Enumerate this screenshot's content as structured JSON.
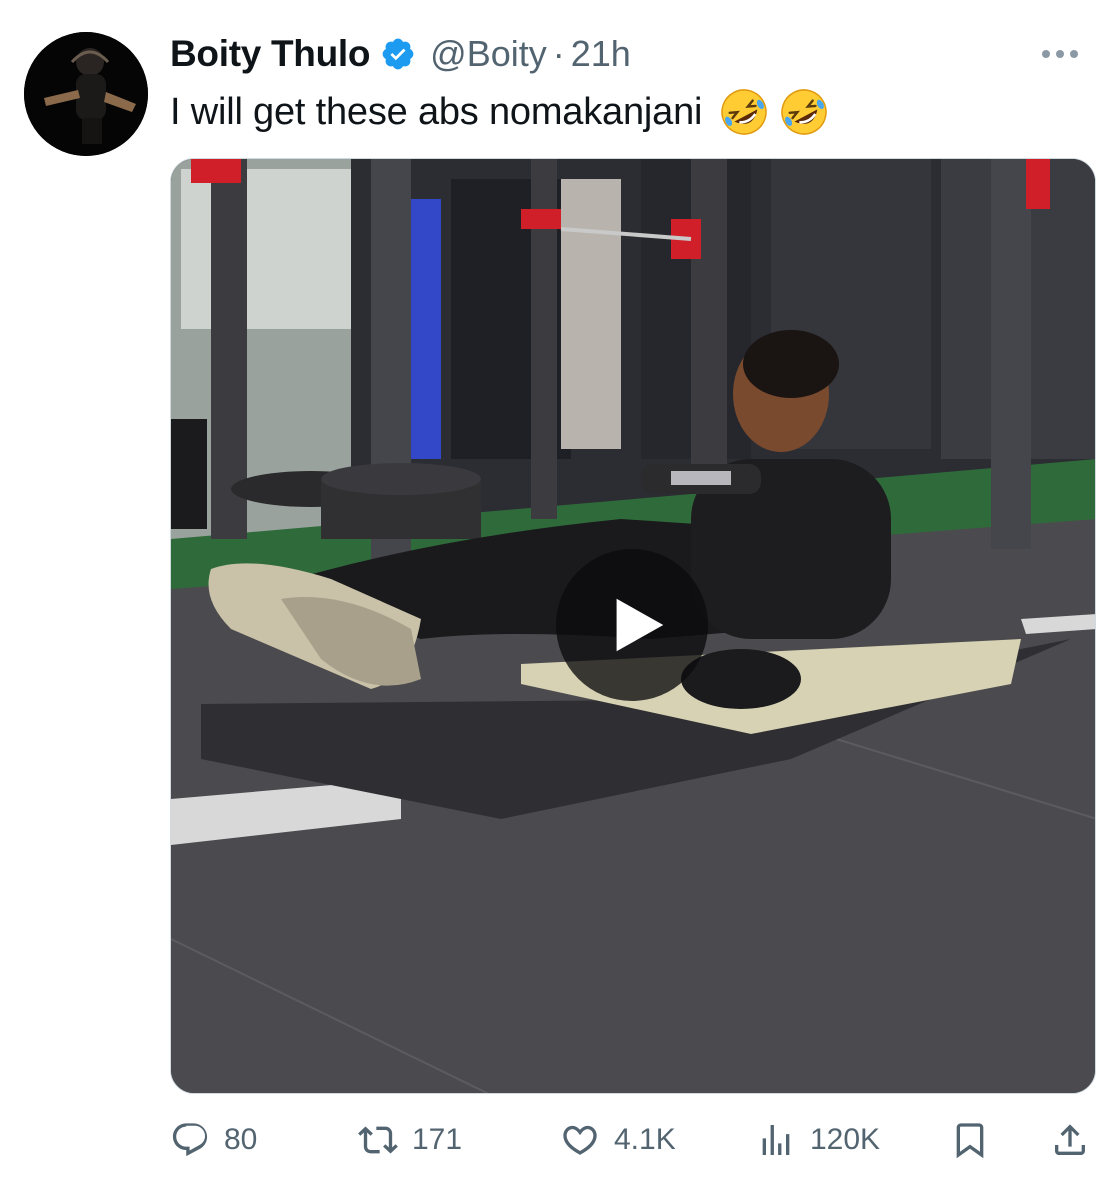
{
  "author": {
    "display_name": "Boity Thulo",
    "verified": true,
    "handle": "@Boity",
    "separator": "·",
    "time": "21h",
    "avatar_icon": "avatar-silhouette"
  },
  "tweet": {
    "text": "I will get these abs nomakanjani",
    "emojis": [
      "rolling-on-the-floor-laughing-emoji",
      "rolling-on-the-floor-laughing-emoji"
    ]
  },
  "media": {
    "type": "video",
    "description_icon": "play-icon"
  },
  "actions": {
    "reply_count": "80",
    "retweet_count": "171",
    "like_count": "4.1K",
    "views_count": "120K"
  },
  "colors": {
    "text": "#0f1419",
    "secondary": "#536471",
    "verified_badge": "#1d9bf0",
    "gym_floor": "#4b4b4f",
    "turf": "#2f6b3a",
    "rack_red": "#d11f2a"
  }
}
